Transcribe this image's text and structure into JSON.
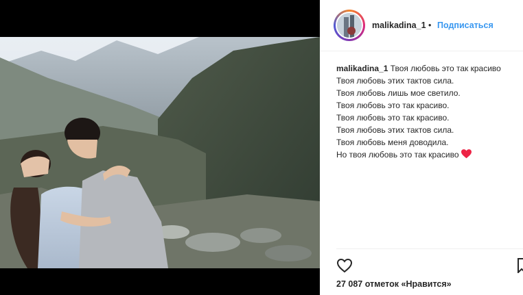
{
  "post": {
    "username": "malikadina_1",
    "separator": "•",
    "follow_label": "Подписаться",
    "caption_lines": [
      "Твоя любовь это так красиво",
      "Твоя любовь этих тактов сила.",
      "Твоя любовь лишь мое светило.",
      "Твоя любовь это так красиво.",
      "Твоя любовь это так красиво.",
      "Твоя любовь этих тактов сила.",
      "Твоя любовь меня доводила.",
      "Но твоя любовь это так красиво"
    ],
    "caption_emoji": "red-heart-emoji",
    "likes_text": "27 087 отметок «Нравится»"
  },
  "icons": {
    "like": "heart-outline-icon",
    "save": "bookmark-icon"
  },
  "colors": {
    "follow": "#3897f0",
    "text": "#262626",
    "heart": "#ed2446"
  }
}
